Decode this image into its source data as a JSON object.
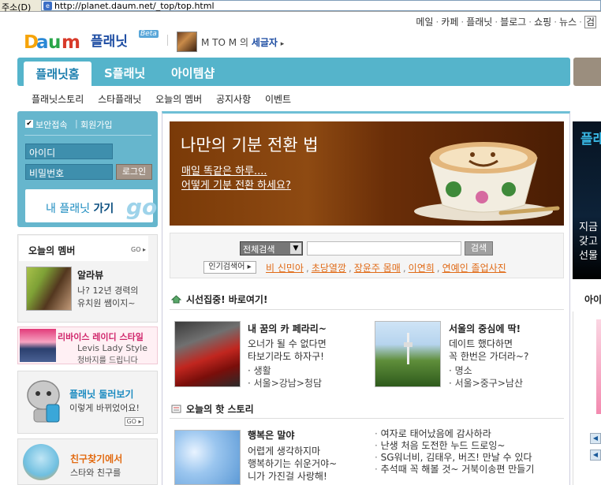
{
  "address_bar": {
    "label": "주소(D)",
    "url": "http://planet.daum.net/_top/top.html"
  },
  "top_nav": {
    "items": [
      "메일",
      "카페",
      "플래닛",
      "블로그",
      "쇼핑",
      "뉴스"
    ],
    "separator": "·",
    "overflow": "검"
  },
  "header": {
    "logo_text": "Daum",
    "service_name": "플래닛",
    "beta_badge": "Beta",
    "username": "M TO M",
    "username_suffix": "의",
    "user_planet_name": "세글자",
    "user_planet_arrow": "▸"
  },
  "main_tabs": [
    {
      "label": "플래닛홈",
      "active": true
    },
    {
      "label": "S플래닛",
      "active": false
    },
    {
      "label": "아이템샵",
      "active": false
    }
  ],
  "sub_nav": [
    "플래닛스토리",
    "스타플래닛",
    "오늘의 멤버",
    "공지사항",
    "이벤트"
  ],
  "login": {
    "secure_checkbox": "✔",
    "secure_label": "보안접속",
    "join_label": "회원가입",
    "id_placeholder": "아이디",
    "pw_placeholder": "비밀번호",
    "login_button": "로그인",
    "my_planet_prefix": "내 플래닛",
    "my_planet_go": "가기",
    "my_planet_big": "go"
  },
  "today_member": {
    "title": "오늘의 멤버",
    "go": "GO ▸",
    "name": "알라뷰",
    "desc_line1": "나? 12년 경력의",
    "desc_line2": "유치원 쌤이지~"
  },
  "levis": {
    "title": "리바이스 레이디 스타일",
    "line1": "Levis Lady Style",
    "line2": "청바지를 드립니다"
  },
  "browse": {
    "title": "플래닛 둘러보기",
    "subtitle": "이렇게 바뀌었어요!",
    "go": "GO ▸"
  },
  "friend": {
    "title": "친구찾기에서",
    "subtitle": "스타와 친구를"
  },
  "hero": {
    "title": "나만의 기분 전환 법",
    "line1": "매일 똑같은 하루....",
    "line2": "어떻게 기분 전환 하세요?"
  },
  "search": {
    "select_value": "전체검색",
    "select_arrow": "▼",
    "button": "검색",
    "popular_label": "인기검색어 ▸",
    "popular_terms": [
      "비 신민아",
      "초당열깡",
      "장윤주 몸매",
      "이연희",
      "연예인 졸업사진"
    ],
    "term_separator": ","
  },
  "focus_section": {
    "title": "시선집중! 바로여기!",
    "cards": [
      {
        "title": "내 꿈의 카 페라리~",
        "line1": "오너가 될 수 없다면",
        "line2": "타보기라도 하자구!",
        "meta1": "· 생활",
        "meta2": "· 서울>강남>청담"
      },
      {
        "title": "서울의 중심에 딱!",
        "line1": "데이트 했다하면",
        "line2": "꼭 한번은 가더라~?",
        "meta1": "· 명소",
        "meta2": "· 서울>중구>남산"
      }
    ]
  },
  "story_section": {
    "title": "오늘의 핫 스토리",
    "card": {
      "title": "행복은 말야",
      "line1": "어렵게 생각하지마",
      "line2": "행복하기는 쉬운거야~",
      "line3": "니가 가진걸 사랑해!"
    },
    "list": [
      "여자로 태어났음에 감사하라",
      "난생 처음 도전한 누드 드로잉~",
      "SG워너비, 김태우, 버즈! 만날 수 있다",
      "추석때 꼭 해볼 것~ 거북이송편 만들기"
    ]
  },
  "right_column": {
    "banner_title": "플래",
    "banner_lines": [
      "지금",
      "갖고",
      "선물"
    ],
    "section_title": "아이",
    "arrow_up": "◀",
    "arrow_down": "◀"
  }
}
